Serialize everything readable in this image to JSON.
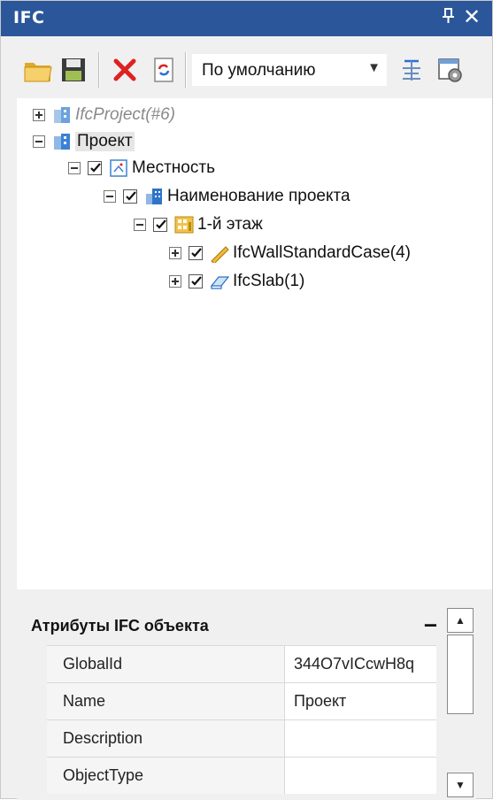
{
  "window": {
    "title": "IFC",
    "pin_glyph": "ף",
    "close_glyph": "✕"
  },
  "toolbar": {
    "buttons": [
      {
        "name": "open-folder-icon"
      },
      {
        "name": "save-disk-icon"
      },
      {
        "name": "delete-x-icon"
      },
      {
        "name": "refresh-icon"
      },
      {
        "name": "filter-icon"
      },
      {
        "name": "settings-icon"
      }
    ],
    "preset_value": "По умолчанию",
    "dropdown_arrow": "▼"
  },
  "tree": {
    "nodes": [
      {
        "label": "IfcProject(#6)"
      },
      {
        "label": "Проект"
      },
      {
        "label": "Местность"
      },
      {
        "label": "Наименование проекта"
      },
      {
        "label": "1-й этаж"
      },
      {
        "label": "IfcWallStandardCase(4)"
      },
      {
        "label": "IfcSlab(1)"
      }
    ]
  },
  "attributes": {
    "title": "Атрибуты IFC объекта",
    "collapse_glyph": "–",
    "rows": [
      {
        "key": "GlobalId",
        "value": "344O7vICcwH8q"
      },
      {
        "key": "Name",
        "value": "Проект"
      },
      {
        "key": "Description",
        "value": ""
      },
      {
        "key": "ObjectType",
        "value": ""
      }
    ]
  },
  "scroll": {
    "up_glyph": "▲",
    "down_glyph": "▼"
  },
  "colors": {
    "titlebar": "#2b579a",
    "panel": "#f0f0f0",
    "accent_red": "#d22",
    "folder_yellow": "#f3c24a"
  }
}
